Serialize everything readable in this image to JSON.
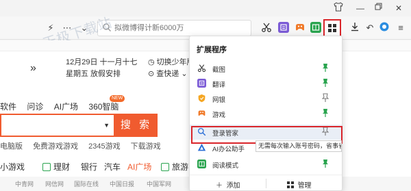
{
  "toolbar": {
    "search_placeholder": "拟微博得计新6000万",
    "watermark": "天极下载站"
  },
  "page": {
    "date_line1": "12月29日 十一月十七",
    "date_line2": "星期五   放假安排",
    "weather_line1": "切换少年版",
    "weather_line2": "查快递",
    "nav_row1": [
      "软件",
      "问诊",
      "AI广场",
      "360智脑"
    ],
    "new_badge": "NEW",
    "search_button": "搜 索",
    "hotwords": [
      "电脑版",
      "免费游戏游戏",
      "2345游戏",
      "下载游戏"
    ],
    "nav_row2": [
      "小游戏",
      "理财",
      "银行",
      "汽车",
      "AI广场",
      "旅游"
    ],
    "bottom_links": [
      "中青网",
      "网信网",
      "国际在线",
      "中国日报",
      "中国军网"
    ]
  },
  "extensions_popup": {
    "title": "扩展程序",
    "items": [
      {
        "label": "截图",
        "icon": "scissors-icon",
        "pinned": true
      },
      {
        "label": "翻译",
        "icon": "translate-icon",
        "pinned": true
      },
      {
        "label": "网银",
        "icon": "bank-shield-icon",
        "pinned": false
      },
      {
        "label": "游戏",
        "icon": "gamepad-icon",
        "pinned": true
      },
      {
        "label": "登录管家",
        "icon": "login-key-icon",
        "pinned": false
      },
      {
        "label": "AI办公助手",
        "icon": "ai-assistant-icon",
        "pinned": false
      },
      {
        "label": "阅读模式",
        "icon": "reader-icon",
        "pinned": true
      }
    ],
    "tooltip": "无需每次输入账号密码，省事省心！",
    "add_label": "添加",
    "manage_label": "管理"
  },
  "colors": {
    "accent_orange": "#f05b2f",
    "highlight_red": "#d9252a",
    "pin_green": "#2aa44f"
  }
}
